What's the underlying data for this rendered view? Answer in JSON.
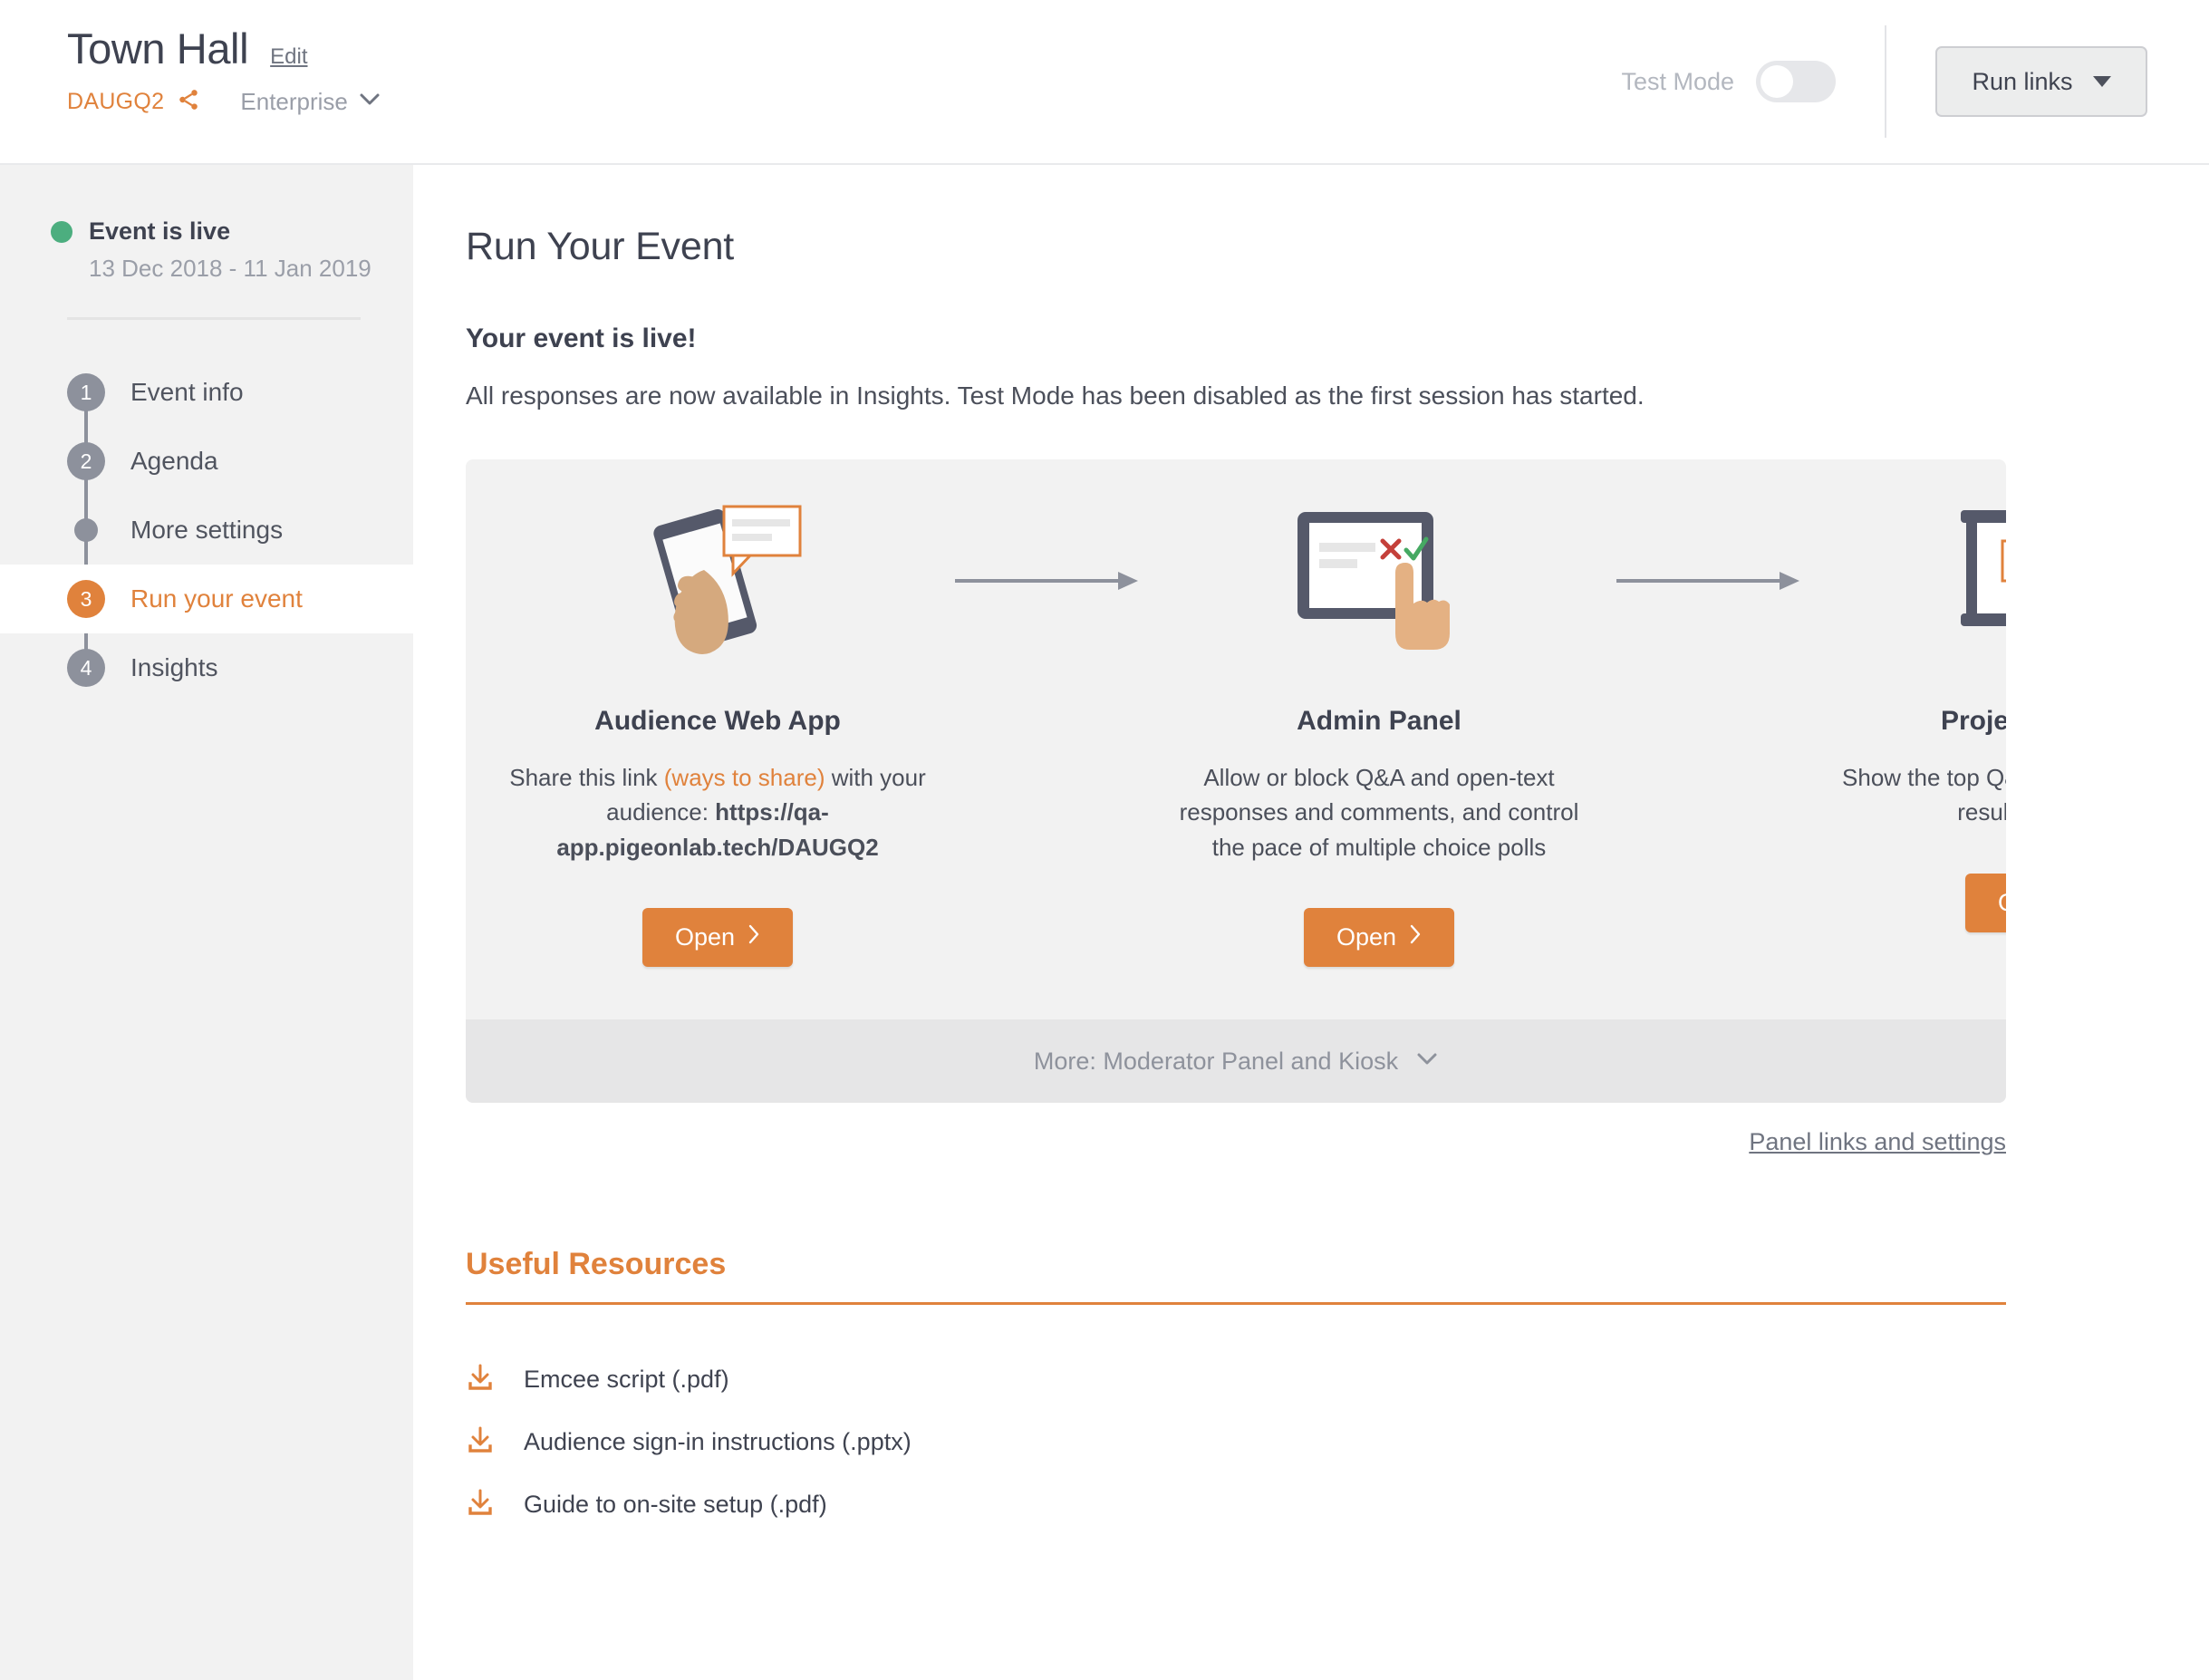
{
  "header": {
    "event_title": "Town Hall",
    "edit_label": "Edit",
    "event_code": "DAUGQ2",
    "share_icon": "share-icon",
    "plan_label": "Enterprise",
    "plan_chevron_icon": "chevron-down-icon",
    "test_mode_label": "Test Mode",
    "test_mode_state": "off",
    "run_links_label": "Run links",
    "run_links_caret_icon": "caret-down-icon"
  },
  "sidebar": {
    "status_label": "Event is live",
    "status_dates": "13 Dec 2018 - 11 Jan 2019",
    "status_dot_color": "#4cae7f",
    "steps": [
      {
        "marker": "1",
        "label": "Event info",
        "kind": "numbered",
        "active": false
      },
      {
        "marker": "2",
        "label": "Agenda",
        "kind": "numbered",
        "active": false
      },
      {
        "marker": "",
        "label": "More settings",
        "kind": "dot",
        "active": false
      },
      {
        "marker": "3",
        "label": "Run your event",
        "kind": "numbered",
        "active": true
      },
      {
        "marker": "4",
        "label": "Insights",
        "kind": "numbered",
        "active": false
      }
    ]
  },
  "main": {
    "page_title": "Run Your Event",
    "live_heading": "Your event is live!",
    "live_subtext": "All responses are now available in Insights. Test Mode has been disabled as the first session has started.",
    "cards": [
      {
        "art_icon": "phone-in-hand-icon",
        "title": "Audience Web App",
        "desc_prefix": "Share this link ",
        "desc_link": "(ways to share)",
        "desc_middle": " with your audience: ",
        "desc_url": "https://qa-app.pigeonlab.tech/DAUGQ2",
        "open_label": "Open"
      },
      {
        "art_icon": "tablet-moderation-icon",
        "title": "Admin Panel",
        "desc": "Allow or block Q&A and open-text responses and comments, and control the pace of multiple choice polls",
        "open_label": "Open"
      },
      {
        "art_icon": "projector-screen-icon",
        "title": "Projector Panel",
        "desc": "Show the top Q&A responses and poll results on stage",
        "open_label": "Open"
      }
    ],
    "connector_icon": "arrow-right-icon",
    "more_bar_label": "More: Moderator Panel and Kiosk",
    "more_bar_chevron_icon": "chevron-down-icon",
    "panel_links_label": "Panel links and settings"
  },
  "resources": {
    "title": "Useful Resources",
    "items": [
      {
        "icon": "download-icon",
        "label": "Emcee script (.pdf)"
      },
      {
        "icon": "download-icon",
        "label": "Audience sign-in instructions (.pptx)"
      },
      {
        "icon": "download-icon",
        "label": "Guide to on-site setup (.pdf)"
      }
    ]
  },
  "colors": {
    "accent": "#e0823c",
    "text": "#3f4350",
    "muted": "#9a9ea8",
    "panel_bg": "#f2f2f2",
    "more_bar_bg": "#e6e6e7",
    "live_green": "#4cae7f"
  }
}
